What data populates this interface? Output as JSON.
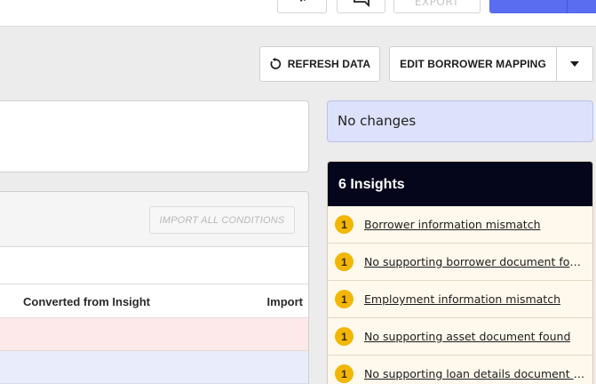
{
  "topbar": {
    "export_label": "EXPORT"
  },
  "toolbar": {
    "refresh_label": "REFRESH DATA",
    "edit_mapping_label": "EDIT BORROWER MAPPING"
  },
  "conditions": {
    "import_all_label": "IMPORT ALL CONDITIONS",
    "columns": [
      "Converted from Insight",
      "Import"
    ]
  },
  "status": {
    "text": "No changes"
  },
  "insights": {
    "title": "6 Insights",
    "items": [
      {
        "count": "1",
        "label": "Borrower information mismatch"
      },
      {
        "count": "1",
        "label": "No supporting borrower document found"
      },
      {
        "count": "1",
        "label": "Employment information mismatch"
      },
      {
        "count": "1",
        "label": "No supporting asset document found"
      },
      {
        "count": "1",
        "label": "No supporting loan details document found"
      }
    ]
  },
  "colors": {
    "primary": "#5a6cf0",
    "status_bg": "#dde1fb",
    "insights_header": "#05061c",
    "badge": "#f2b705",
    "row_error": "#fde9ea",
    "row_info": "#e9ecfb"
  }
}
